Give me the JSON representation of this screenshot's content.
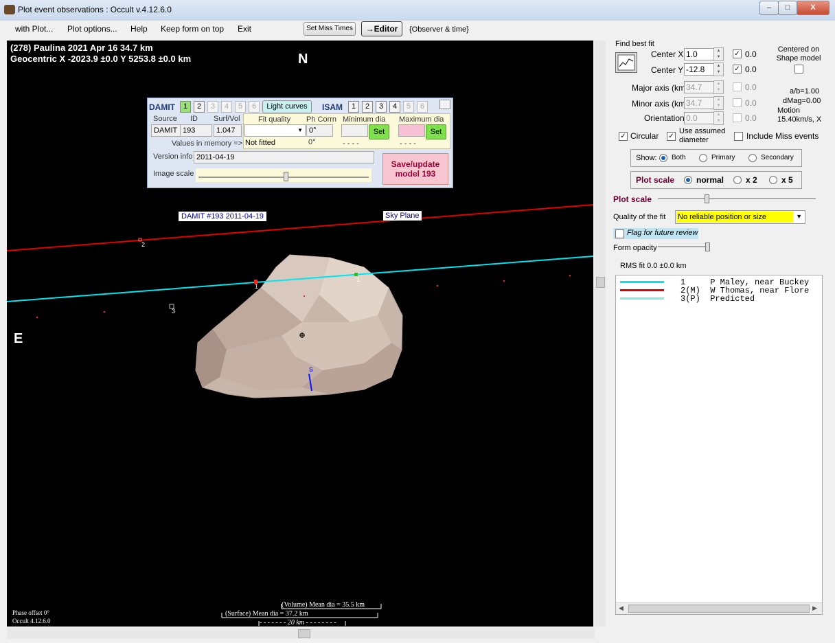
{
  "window": {
    "title": "Plot event observations : Occult v.4.12.6.0",
    "controls": {
      "minimize": "–",
      "maximize": "□",
      "close": "X"
    }
  },
  "menu": {
    "items": [
      "with Plot...",
      "Plot options...",
      "Help",
      "Keep form on top",
      "Exit"
    ],
    "set_miss_times": "Set Miss Times",
    "editor": "→Editor",
    "observer_time": "{Observer & time}"
  },
  "plot": {
    "header_line1": "(278) Paulina  2021 Apr 16   34.7 km",
    "header_line2": "Geocentric X  -2023.9 ±0.0  Y 5253.8 ±0.0 km",
    "north": "N",
    "east": "E",
    "model_label": "DAMIT #193 2011-04-19",
    "sky_plane": "Sky Plane",
    "south_marker": "S",
    "chord_labels": [
      "1",
      "1",
      "2",
      "3"
    ],
    "volume_dia": "(Volume) Mean dia = 35.5 km",
    "surface_dia": "(Surface) Mean dia = 37.2 km",
    "scale_bar": "20 km",
    "phase_offset": "Phase offset 0°",
    "occult_version": "Occult 4.12.6.0"
  },
  "damit": {
    "label": "DAMIT",
    "model_numbers": [
      "1",
      "2",
      "3",
      "4",
      "5",
      "6"
    ],
    "light_curves": "Light curves",
    "isam_label": "ISAM",
    "isam_numbers": [
      "1",
      "2",
      "3",
      "4",
      "5",
      "6"
    ],
    "headers": {
      "source": "Source",
      "id": "ID",
      "surfvol": "Surf/Vol",
      "fit_quality": "Fit quality",
      "ph_corrn": "Ph Corrn",
      "min_dia": "Minimum dia",
      "max_dia": "Maximum dia"
    },
    "source_value": "DAMIT",
    "id_value": "193",
    "surfvol_value": "1.047",
    "ph_corrn_value": "0°",
    "values_in_memory": "Values in memory =>",
    "not_fitted": "Not fitted",
    "ph_corrn_memory": "0°",
    "min_dia_memory": "- - - -",
    "max_dia_memory": "- - - -",
    "set_label": "Set",
    "version_info_label": "Version info",
    "version_info_value": "2011-04-19",
    "image_scale_label": "Image scale",
    "save_update": "Save/update model 193"
  },
  "fit": {
    "find_best_fit": "Find best fit",
    "center_x_label": "Center X",
    "center_x": "1.0",
    "center_y_label": "Center Y",
    "center_y": "-12.8",
    "center_x_check": "0.0",
    "center_y_check": "0.0",
    "centered_on": "Centered on Shape model",
    "major_axis_label": "Major axis (km)",
    "major_axis": "34.7",
    "minor_axis_label": "Minor axis (km)",
    "minor_axis": "34.7",
    "orientation_label": "Orientation",
    "orientation": "0.0",
    "major_check": "0.0",
    "minor_check": "0.0",
    "orient_check": "0.0",
    "ab_ratio": "a/b=1.00",
    "dmag": "dMag=0.00",
    "motion_label": "Motion",
    "motion_value": "15.40km/s, X",
    "circular": "Circular",
    "use_assumed": "Use assumed diameter",
    "include_miss": "Include Miss events",
    "show_label": "Show:",
    "show_both": "Both",
    "show_primary": "Primary",
    "show_secondary": "Secondary",
    "plot_scale_label": "Plot scale",
    "scale_normal": "normal",
    "scale_x2": "x 2",
    "scale_x5": "x 5",
    "plot_scale_slider_label": "Plot scale",
    "quality_label": "Quality of the fit",
    "quality_value": "No reliable position or size",
    "flag_review": "Flag for future review",
    "form_opacity": "Form opacity",
    "rms_fit": "RMS fit 0.0 ±0.0 km"
  },
  "legend": {
    "entries": [
      {
        "num": "1   ",
        "name": "P Maley, near Buckey",
        "color": "#00e5ee"
      },
      {
        "num": "2(M)",
        "name": "W Thomas, near Flore",
        "color": "#e00000"
      },
      {
        "num": "3(P)",
        "name": "Predicted",
        "color": "#7fe8e0"
      }
    ]
  }
}
